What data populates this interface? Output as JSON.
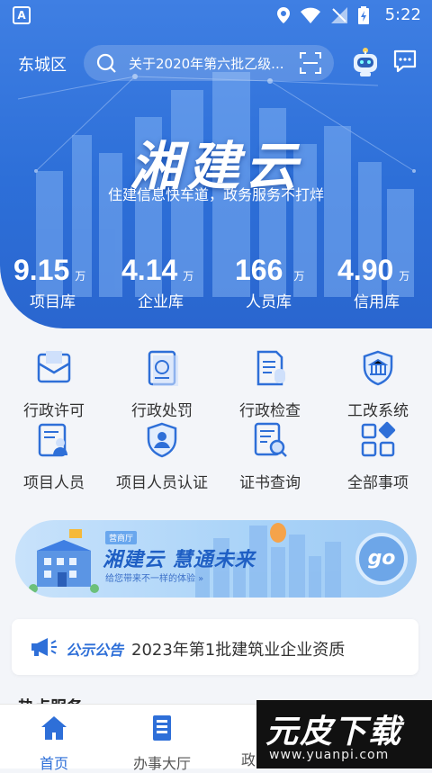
{
  "status_bar": {
    "time": "5:22"
  },
  "header": {
    "district": "东城区",
    "search_placeholder": "关于2020年第六批乙级..."
  },
  "hero": {
    "brand": "湘建云",
    "slogan": "住建信息快车道，政务服务不打烊"
  },
  "stats": [
    {
      "value": "9.15",
      "unit": "万",
      "label": "项目库"
    },
    {
      "value": "4.14",
      "unit": "万",
      "label": "企业库"
    },
    {
      "value": "166",
      "unit": "万",
      "label": "人员库"
    },
    {
      "value": "4.90",
      "unit": "万",
      "label": "信用库"
    }
  ],
  "services": [
    {
      "label": "行政许可",
      "icon": "license-icon"
    },
    {
      "label": "行政处罚",
      "icon": "penalty-icon"
    },
    {
      "label": "行政检查",
      "icon": "inspection-icon"
    },
    {
      "label": "工改系统",
      "icon": "bank-shield-icon"
    },
    {
      "label": "项目人员",
      "icon": "staff-icon"
    },
    {
      "label": "项目人员认证",
      "icon": "user-shield-icon"
    },
    {
      "label": "证书查询",
      "icon": "certificate-search-icon"
    },
    {
      "label": "全部事项",
      "icon": "all-items-icon"
    }
  ],
  "banner": {
    "tag": "营商厅",
    "title": "湘建云   慧通未来",
    "subtitle": "给您带来不一样的体验 »",
    "go": "go"
  },
  "notice": {
    "label": "公示公告",
    "text": "2023年第1批建筑业企业资质"
  },
  "section_title": "热点服务",
  "tabs": [
    {
      "label": "首页",
      "active": true
    },
    {
      "label": "办事大厅",
      "active": false
    },
    {
      "label": "政务",
      "active": false
    }
  ],
  "watermark": {
    "title": "元皮下载",
    "url": "www.yuanpi.com"
  },
  "colors": {
    "primary": "#2e6fd8",
    "hero": "#3f7fe3"
  }
}
